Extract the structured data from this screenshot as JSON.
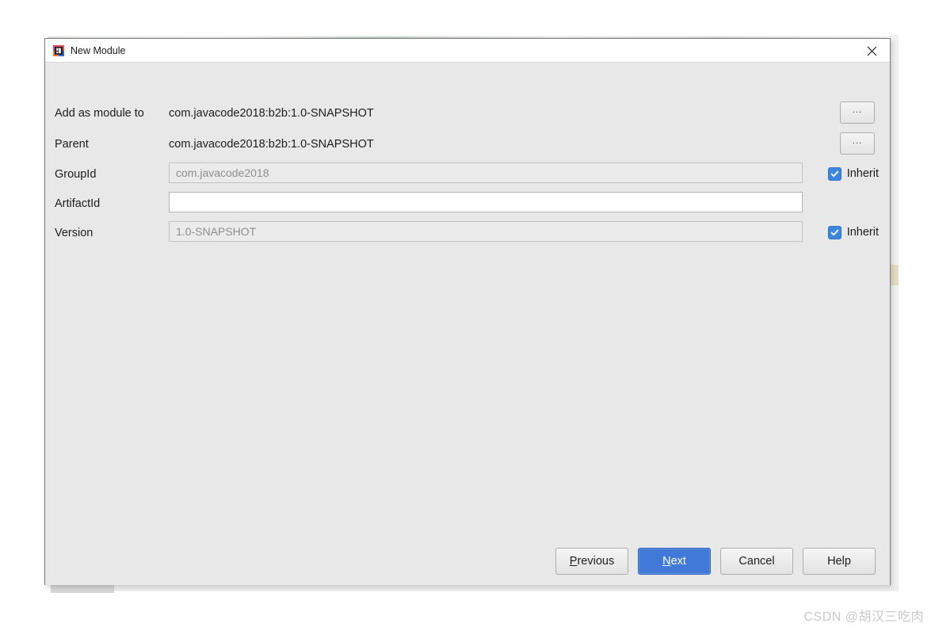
{
  "window": {
    "title": "New Module",
    "icon": "intellij-module-icon",
    "close_icon": "close-icon",
    "titlebar_bg": "#ffffff",
    "content_bg": "#e8e8e8",
    "border_color": "#7a7a7a"
  },
  "form": {
    "rows": [
      {
        "id": "add-as-module-to",
        "label": "Add as module to",
        "kind": "static",
        "value": "com.javacode2018:b2b:1.0-SNAPSHOT",
        "trailing": "dots-button",
        "trailing_label": "..."
      },
      {
        "id": "parent",
        "label": "Parent",
        "kind": "static",
        "value": "com.javacode2018:b2b:1.0-SNAPSHOT",
        "trailing": "dots-button",
        "trailing_label": "..."
      },
      {
        "id": "group-id",
        "label": "GroupId",
        "kind": "input",
        "value": "com.javacode2018",
        "placeholder": "",
        "disabled": true,
        "trailing": "inherit-checkbox",
        "trailing_label": "Inherit",
        "trailing_checked": true
      },
      {
        "id": "artifact-id",
        "label": "ArtifactId",
        "kind": "input",
        "value": "",
        "placeholder": "",
        "disabled": false,
        "trailing": "none",
        "trailing_label": "",
        "trailing_checked": false
      },
      {
        "id": "version",
        "label": "Version",
        "kind": "input",
        "value": "1.0-SNAPSHOT",
        "placeholder": "",
        "disabled": true,
        "trailing": "inherit-checkbox",
        "trailing_label": "Inherit",
        "trailing_checked": true
      }
    ]
  },
  "buttons": {
    "previous": "Previous",
    "previous_mnemonic": "P",
    "next": "Next",
    "next_mnemonic": "N",
    "cancel": "Cancel",
    "help": "Help",
    "primary_color": "#4079d8"
  },
  "colors": {
    "accent": "#4079d8",
    "checkbox": "#3d86e0",
    "disabled_field_bg": "#ebebeb",
    "disabled_text": "#8e8e8e"
  },
  "watermark": {
    "text": "CSDN @胡汉三吃肉"
  }
}
